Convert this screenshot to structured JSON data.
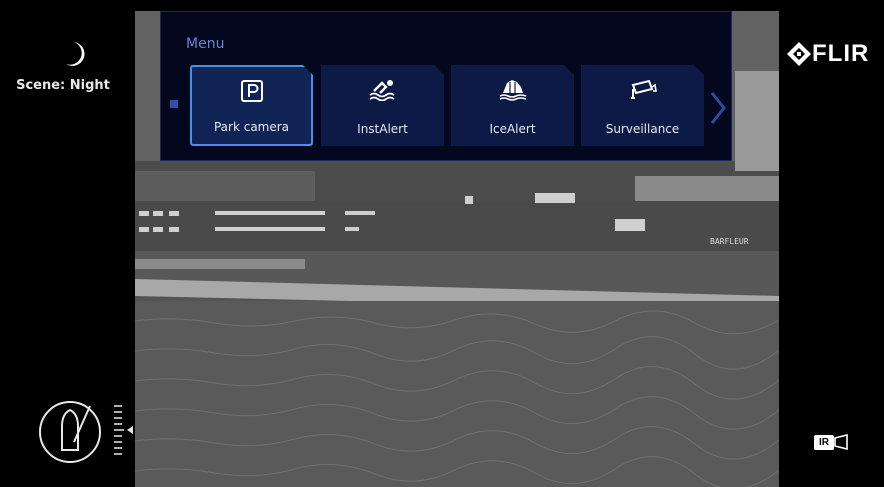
{
  "scene": {
    "label": "Scene: Night",
    "icon": "moon-icon"
  },
  "brand": {
    "logo_text": "FLIR",
    "icon": "flir-emblem-icon"
  },
  "menu": {
    "title": "Menu",
    "items": [
      {
        "label": "Park camera",
        "icon": "parking-icon",
        "selected": true
      },
      {
        "label": "InstAlert",
        "icon": "swimmer-icon",
        "selected": false
      },
      {
        "label": "IceAlert",
        "icon": "ice-icon",
        "selected": false
      },
      {
        "label": "Surveillance",
        "icon": "camera-icon",
        "selected": false
      }
    ]
  },
  "camera_mode": {
    "label": "IR",
    "icon": "video-camera-icon"
  },
  "ship": {
    "name_text": "BARFLEUR"
  },
  "colors": {
    "accent": "#4a8ef0",
    "menu_bg": "#04081e",
    "tile_bg": "#0d1a45",
    "title": "#6a82d4"
  }
}
